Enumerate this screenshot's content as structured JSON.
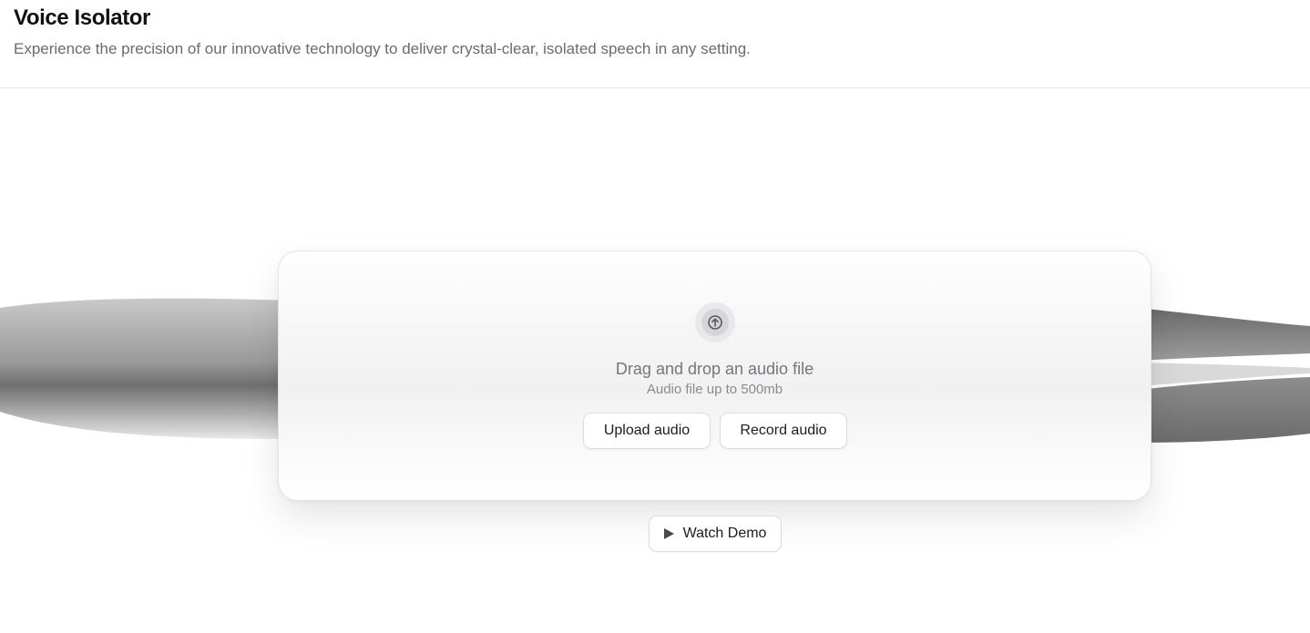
{
  "header": {
    "title": "Voice Isolator",
    "subtitle": "Experience the precision of our innovative technology to deliver crystal-clear, isolated speech in any setting."
  },
  "upload_card": {
    "icon": "upload-arrow-icon",
    "title": "Drag and drop an audio file",
    "hint": "Audio file up to 500mb",
    "upload_label": "Upload audio",
    "record_label": "Record audio"
  },
  "demo": {
    "icon": "play-icon",
    "label": "Watch Demo"
  },
  "colors": {
    "background": "#ffffff",
    "title": "#111111",
    "subtitle": "#6b6b6b",
    "wave": "#8c8c8c",
    "button_border": "#dcdcdc"
  }
}
